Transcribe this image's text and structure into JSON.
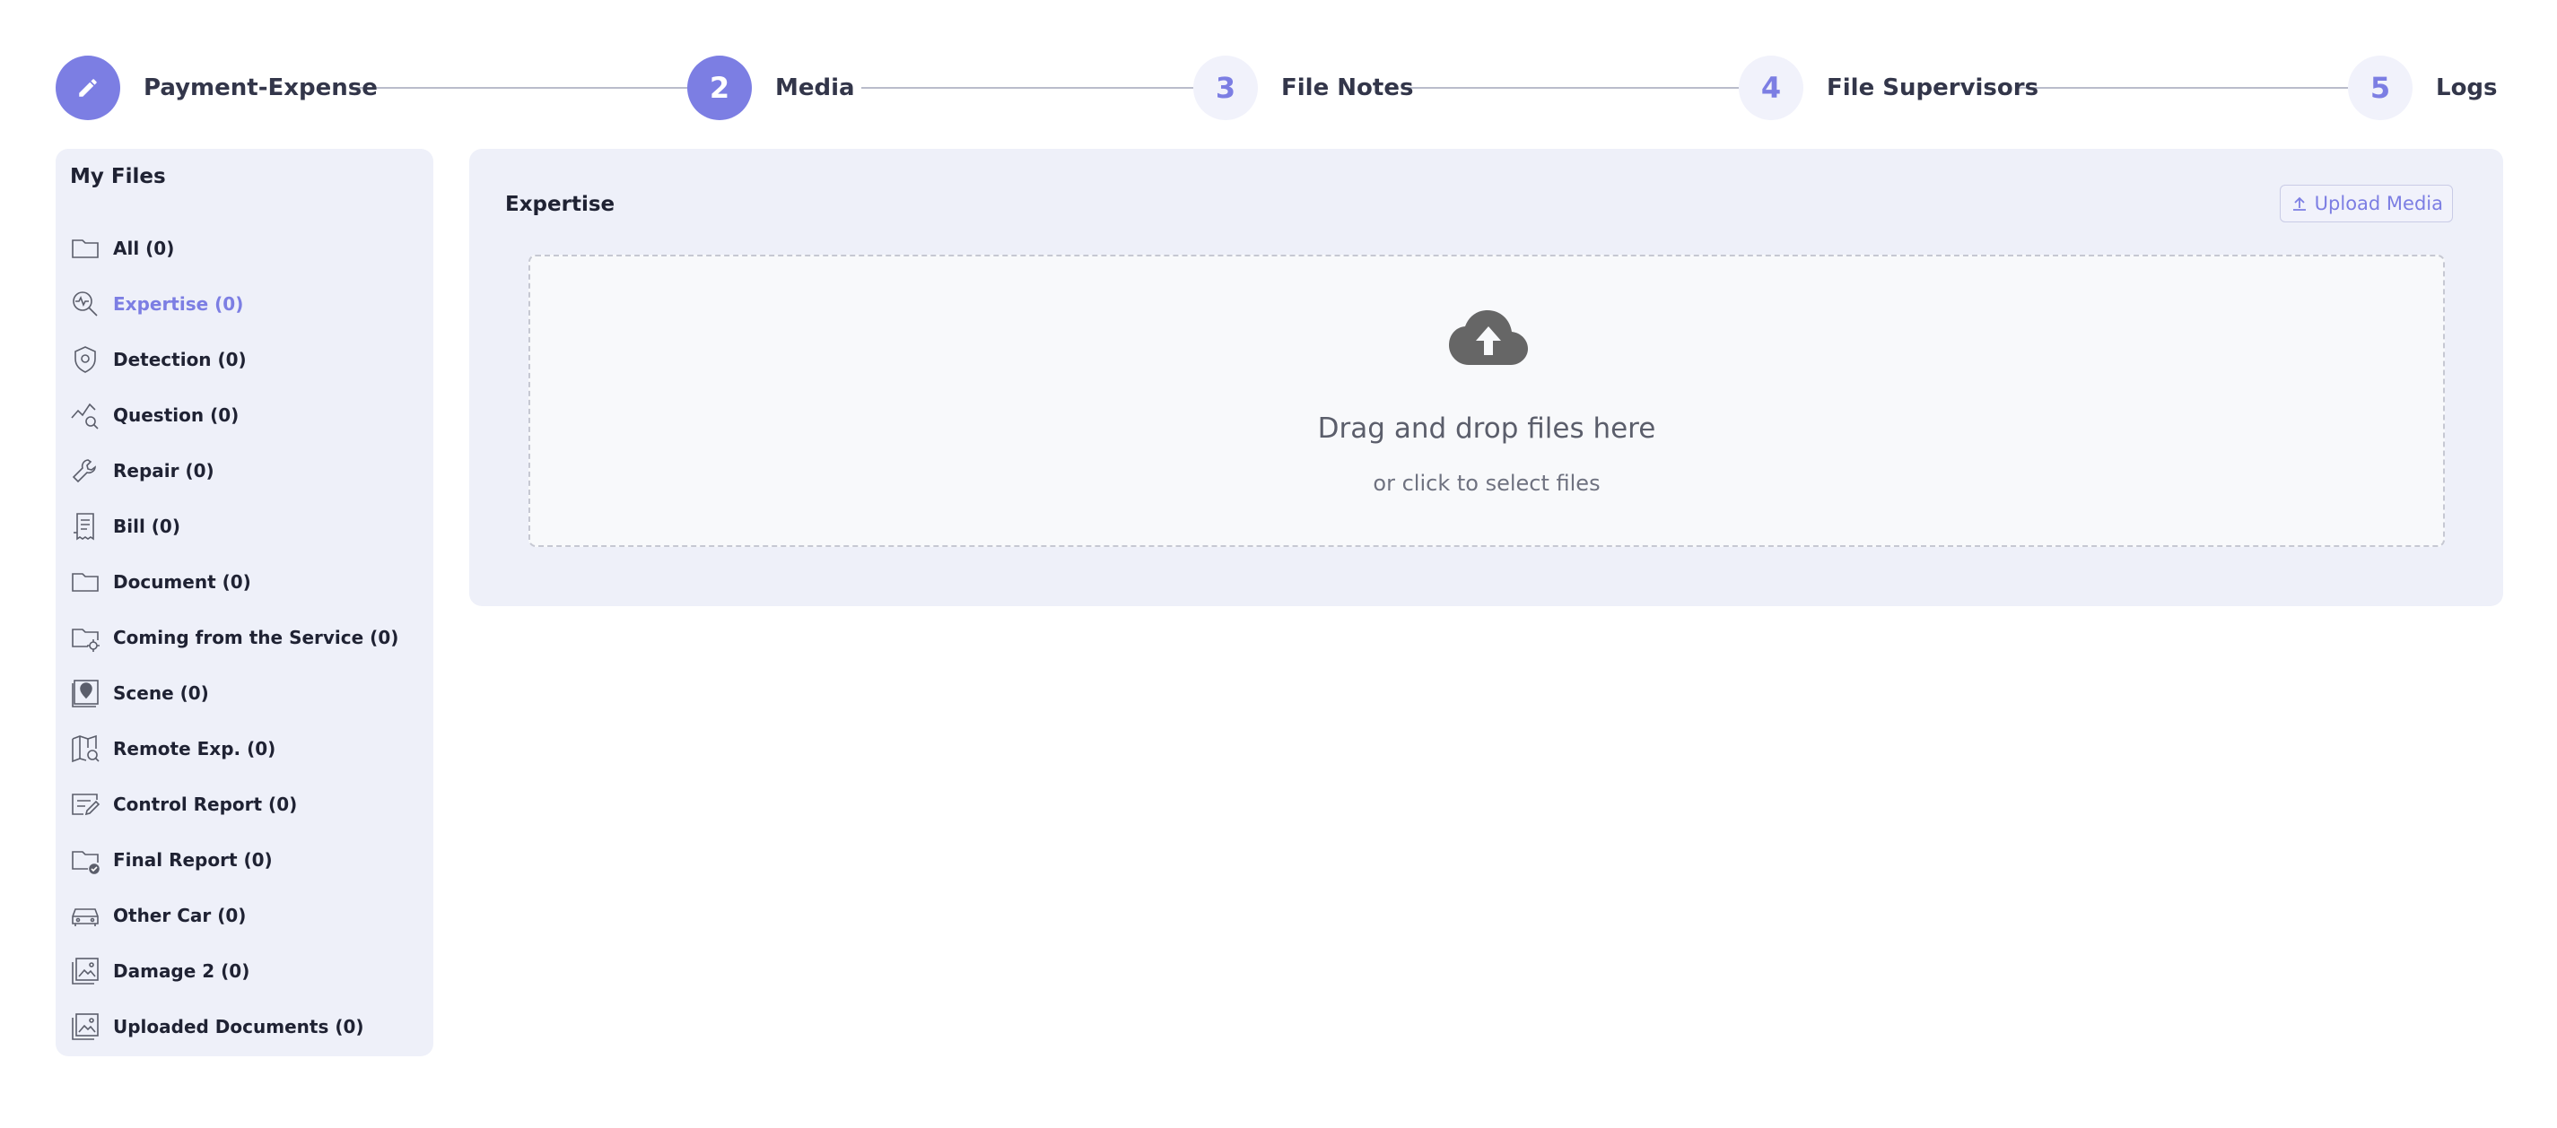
{
  "stepper": {
    "steps": [
      {
        "number": "",
        "label": "Payment-Expense",
        "state": "completed",
        "icon": "pencil-icon"
      },
      {
        "number": "2",
        "label": "Media",
        "state": "active"
      },
      {
        "number": "3",
        "label": "File Notes",
        "state": "pending"
      },
      {
        "number": "4",
        "label": "File Supervisors",
        "state": "pending"
      },
      {
        "number": "5",
        "label": "Logs",
        "state": "pending"
      }
    ]
  },
  "sidebar": {
    "title": "My Files",
    "items": [
      {
        "label": "All (0)",
        "icon": "folder-icon"
      },
      {
        "label": "Expertise (0)",
        "icon": "expertise-search-icon",
        "selected": true
      },
      {
        "label": "Detection (0)",
        "icon": "shield-icon"
      },
      {
        "label": "Question (0)",
        "icon": "chart-search-icon"
      },
      {
        "label": "Repair (0)",
        "icon": "wrench-icon"
      },
      {
        "label": "Bill (0)",
        "icon": "receipt-icon"
      },
      {
        "label": "Document (0)",
        "icon": "folder-icon"
      },
      {
        "label": "Coming from the Service (0)",
        "icon": "folder-gear-icon"
      },
      {
        "label": "Scene (0)",
        "icon": "map-pin-icon"
      },
      {
        "label": "Remote Exp. (0)",
        "icon": "map-search-icon"
      },
      {
        "label": "Control Report (0)",
        "icon": "report-edit-icon"
      },
      {
        "label": "Final Report (0)",
        "icon": "folder-check-icon"
      },
      {
        "label": "Other Car (0)",
        "icon": "car-icon"
      },
      {
        "label": "Damage 2 (0)",
        "icon": "image-stack-icon"
      },
      {
        "label": "Uploaded Documents (0)",
        "icon": "image-stack-icon"
      }
    ]
  },
  "main": {
    "title": "Expertise",
    "upload_button": "Upload Media",
    "dropzone": {
      "title": "Drag and drop files here",
      "subtitle": "or click to select files",
      "icon": "cloud-upload-icon"
    }
  },
  "colors": {
    "accent": "#7c7ee3",
    "panel_bg": "#eef0f9",
    "text": "#1f2233"
  }
}
